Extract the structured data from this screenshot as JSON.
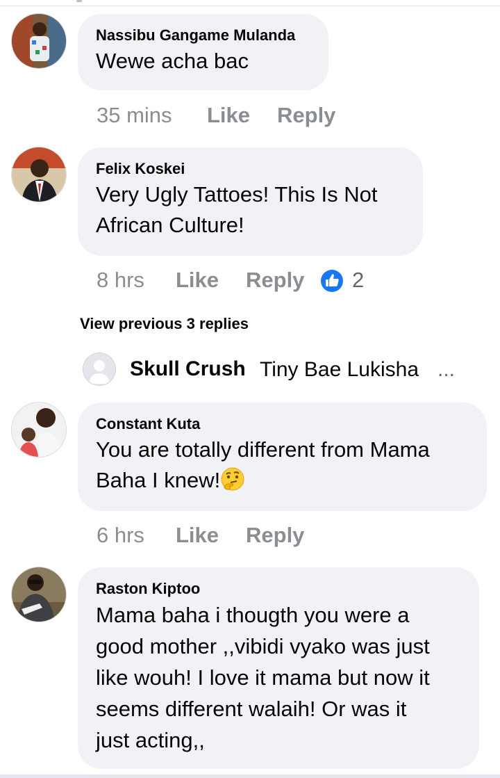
{
  "comments": [
    {
      "author": "Nassibu Gangame Mulanda",
      "lines": [
        "Wewe acha bac"
      ],
      "time": "35 mins",
      "like_label": "Like",
      "reply_label": "Reply"
    },
    {
      "author": "Felix Koskei",
      "lines": [
        "Very Ugly Tattoes! This Is Not",
        "African Culture!"
      ],
      "time": "8 hrs",
      "like_label": "Like",
      "reply_label": "Reply",
      "reaction_icon": "like-thumbs-up-icon",
      "reaction_count": "2"
    },
    {
      "author": "Constant Kuta",
      "lines": [
        "You are totally different from Mama",
        "Baha I knew!"
      ],
      "emoji": "thinking-face-icon",
      "time": "6 hrs",
      "like_label": "Like",
      "reply_label": "Reply"
    },
    {
      "author": "Raston Kiptoo",
      "lines": [
        "Mama baha i thougth you were a",
        "good mother ,,vibidi vyako was just",
        "like wouh! I love it mama but now it",
        "seems different walaih! Or was it",
        "just acting,,"
      ]
    }
  ],
  "view_previous_replies": "View previous 3 replies",
  "reply_preview": {
    "author": "Skull Crush",
    "text": "Tiny Bae Lukisha",
    "ellipsis": "..."
  },
  "colors": {
    "bubble": "#f0f2f5",
    "action_text": "#8a8d91",
    "like_blue": "#1877f2"
  }
}
